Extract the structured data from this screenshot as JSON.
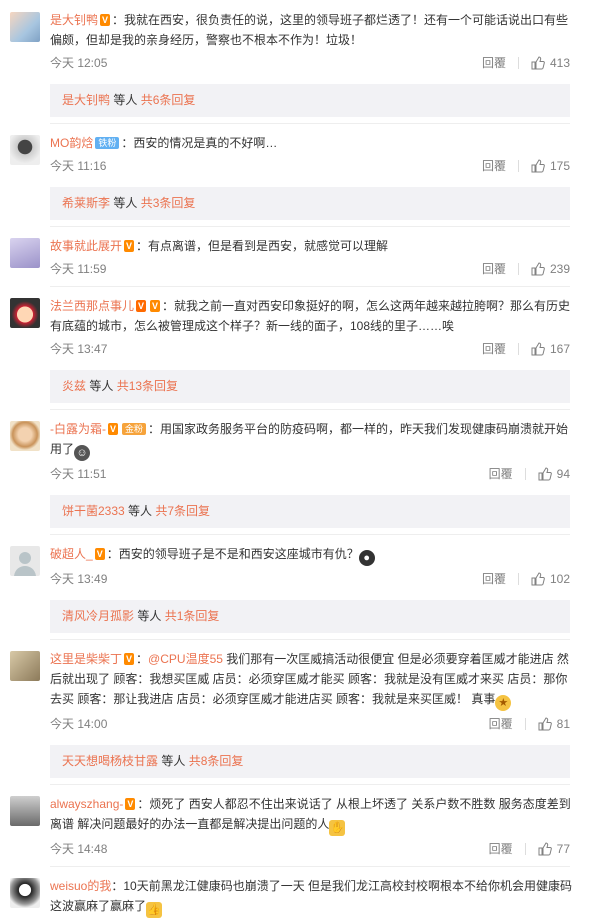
{
  "comments": [
    {
      "name": "是大钊鸭",
      "text": "：我就在西安，很负责任的说，这里的领导班子都烂透了！还有一个可能话说出口有些偏颇，但却是我的亲身经历，警察也不根本不作为！垃圾！",
      "time": "今天 12:05",
      "reply": "回覆",
      "likes": "413",
      "more": {
        "user": "是大钊鸭",
        "text": " 等人 ",
        "count": "共6条回复"
      }
    },
    {
      "name": "MO韵焓",
      "badge": "铁粉",
      "text": "：西安的情况是真的不好啊…",
      "time": "今天 11:16",
      "reply": "回覆",
      "likes": "175",
      "more": {
        "user": "希莱斯李",
        "text": " 等人 ",
        "count": "共3条回复"
      }
    },
    {
      "name": "故事就此展开",
      "text": "：有点离谱，但是看到是西安，就感觉可以理解",
      "time": "今天 11:59",
      "reply": "回覆",
      "likes": "239"
    },
    {
      "name": "法兰西那点事儿",
      "text": "：就我之前一直对西安印象挺好的啊，怎么这两年越来越拉胯啊？那么有历史有底蕴的城市，怎么被管理成这个样子？新一线的面子，108线的里子……唉",
      "time": "今天 13:47",
      "reply": "回覆",
      "likes": "167",
      "more": {
        "user": "炎兹",
        "text": " 等人 ",
        "count": "共13条回复"
      }
    },
    {
      "name": "-白露为霜-",
      "badge": "金粉",
      "text": "：用国家政务服务平台的防疫码啊，都一样的，昨天我们发现健康码崩溃就开始用了",
      "time": "今天 11:51",
      "reply": "回覆",
      "likes": "94",
      "more": {
        "user": "饼干菌2333",
        "text": " 等人 ",
        "count": "共7条回复"
      }
    },
    {
      "name": "破超人_",
      "text": "：西安的领导班子是不是和西安这座城市有仇？",
      "time": "今天 13:49",
      "reply": "回覆",
      "likes": "102",
      "more": {
        "user": "清风冷月孤影",
        "text": " 等人 ",
        "count": "共1条回复"
      }
    },
    {
      "name": "这里是柴柴丁",
      "mention": "@CPU温度55",
      "text": " 我们那有一次匡威搞活动很便宜 但是必须要穿着匡威才能进店 然后就出现了 顾客：我想买匡威  店员：必须穿匡威才能买 顾客：我就是没有匡威才来买 店员：那你去买 顾客：那让我进店 店员：必须穿匡威才能进店买 顾客：我就是来买匡威！   真事",
      "time": "今天 14:00",
      "reply": "回覆",
      "likes": "81",
      "more": {
        "user": "天天想喝杨枝甘露",
        "text": " 等人 ",
        "count": "共8条回复"
      }
    },
    {
      "name": "alwayszhang-",
      "text": "：烦死了 西安人都忍不住出来说话了 从根上坏透了 关系户数不胜数 服务态度差到离谱 解决问题最好的办法一直都是解决提出问题的人",
      "time": "今天 14:48",
      "reply": "回覆",
      "likes": "77"
    },
    {
      "name": "weisuo的我",
      "text": "：10天前黑龙江健康码也崩溃了一天 但是我们龙江高校封校啊根本不给你机会用健康码 这波赢麻了赢麻了",
      "time": "",
      "reply": "",
      "likes": ""
    }
  ],
  "colors": {
    "accent": "#eb7350",
    "meta": "#808080",
    "reply_bg": "#f2f2f5"
  }
}
